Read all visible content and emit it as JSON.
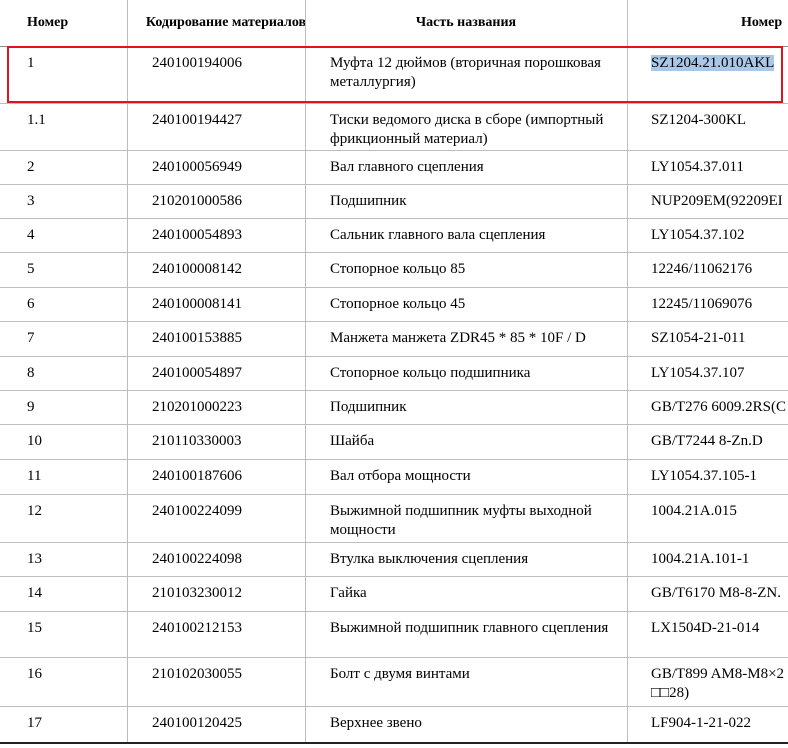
{
  "header": {
    "col_number": "Номер",
    "col_code": "Кодирование материалов",
    "col_name": "Часть названия",
    "col_part": "Номер"
  },
  "rows": [
    {
      "num": "1",
      "code": "240100194006",
      "name": "Муфта 12 дюймов (вторичная порошковая металлургия)",
      "part": "SZ1204.21.010AKL"
    },
    {
      "num": "1.1",
      "code": "240100194427",
      "name": "Тиски ведомого диска в сборе (импортный фрикционный материал)",
      "part": "SZ1204-300KL"
    },
    {
      "num": "2",
      "code": "240100056949",
      "name": "Вал главного сцепления",
      "part": "LY1054.37.011"
    },
    {
      "num": "3",
      "code": "210201000586",
      "name": "Подшипник",
      "part": "NUP209EM(92209EI"
    },
    {
      "num": "4",
      "code": "240100054893",
      "name": "Сальник главного вала сцепления",
      "part": "LY1054.37.102"
    },
    {
      "num": "5",
      "code": "240100008142",
      "name": "Стопорное кольцо 85",
      "part": "12246/11062176"
    },
    {
      "num": "6",
      "code": "240100008141",
      "name": "Стопорное кольцо 45",
      "part": "12245/11069076"
    },
    {
      "num": "7",
      "code": "240100153885",
      "name": "Манжета манжета ZDR45 * 85 * 10F / D",
      "part": "SZ1054-21-011"
    },
    {
      "num": "8",
      "code": "240100054897",
      "name": "Стопорное кольцо подшипника",
      "part": "LY1054.37.107"
    },
    {
      "num": "9",
      "code": "210201000223",
      "name": "Подшипник",
      "part": "GB/T276 6009.2RS(C"
    },
    {
      "num": "10",
      "code": "210110330003",
      "name": "Шайба",
      "part": "GB/T7244 8-Zn.D"
    },
    {
      "num": "11",
      "code": "240100187606",
      "name": "Вал отбора мощности",
      "part": "LY1054.37.105-1"
    },
    {
      "num": "12",
      "code": "240100224099",
      "name": "Выжимной подшипник муфты выходной мощности",
      "part": "1004.21A.015"
    },
    {
      "num": "13",
      "code": "240100224098",
      "name": "Втулка выключения сцепления",
      "part": "1004.21A.101-1"
    },
    {
      "num": "14",
      "code": "210103230012",
      "name": "Гайка",
      "part": "GB/T6170 M8-8-ZN."
    },
    {
      "num": "15",
      "code": "240100212153",
      "name": "Выжимной подшипник главного сцепления",
      "part": "LX1504D-21-014"
    },
    {
      "num": "16",
      "code": "210102030055",
      "name": "Болт с двумя винтами",
      "part": "GB/T899 AM8-M8×2 □□28)"
    },
    {
      "num": "17",
      "code": "240100120425",
      "name": "Верхнее звено",
      "part": "LF904-1-21-022"
    }
  ],
  "selection": {
    "highlight_color": "#a9c8e8",
    "box_color": "#e0141e"
  }
}
